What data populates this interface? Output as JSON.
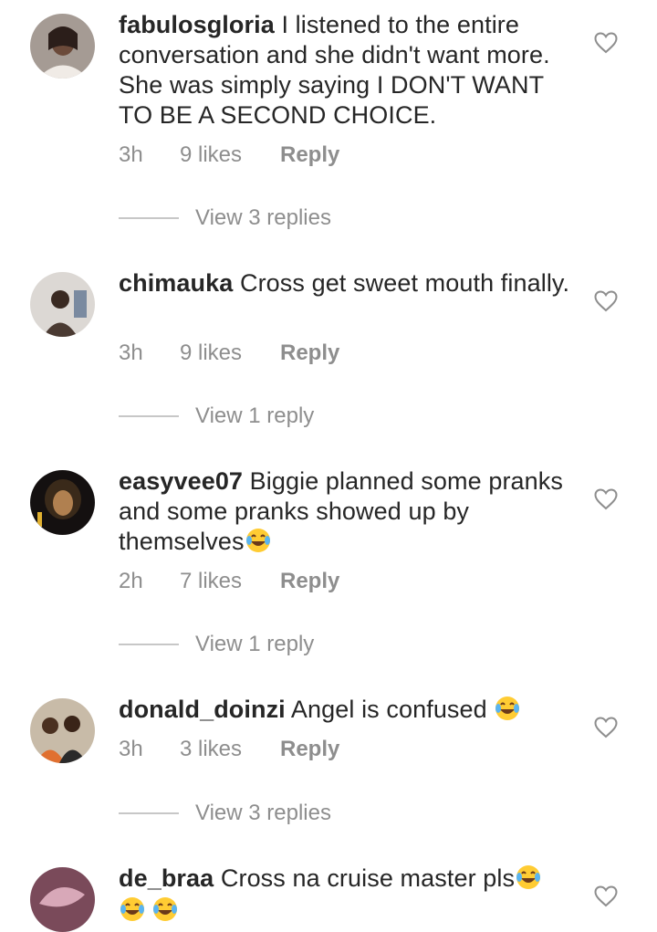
{
  "comments": [
    {
      "username": "fabulosgloria",
      "text": "I listened to the entire conversation and she didn't want more. She was simply saying I DON'T WANT TO BE A SECOND CHOICE.",
      "time": "3h",
      "likes": "9 likes",
      "reply_label": "Reply",
      "view_replies": "View 3 replies",
      "avatar_colors": [
        "#9a8f87",
        "#2b1e1a"
      ]
    },
    {
      "username": "chimauka",
      "text": "Cross get sweet mouth finally.",
      "time": "3h",
      "likes": "9 likes",
      "reply_label": "Reply",
      "view_replies": "View 1 reply",
      "avatar_colors": [
        "#d9d6d2",
        "#3a2a22"
      ]
    },
    {
      "username": "easyvee07",
      "text": "Biggie planned some pranks and some pranks showed up by themselves",
      "emoji": "face-with-tears-of-joy",
      "time": "2h",
      "likes": "7 likes",
      "reply_label": "Reply",
      "view_replies": "View 1 reply",
      "avatar_colors": [
        "#1a1410",
        "#8a6a3a"
      ]
    },
    {
      "username": "donald_doinzi",
      "text": "Angel is confused ",
      "emoji": "face-with-tears-of-joy",
      "time": "3h",
      "likes": "3 likes",
      "reply_label": "Reply",
      "view_replies": "View 3 replies",
      "avatar_colors": [
        "#cfc2b0",
        "#5a3a2a"
      ]
    },
    {
      "username": "de_braa",
      "text": "Cross na cruise master pls",
      "emoji": "face-with-tears-of-joy",
      "avatar_colors": [
        "#6b3a4a",
        "#c9a0b0"
      ]
    }
  ],
  "colors": {
    "text": "#262626",
    "muted": "#8e8e8e",
    "divider": "#c7c7c7"
  },
  "icons": {
    "like": "heart-outline-icon",
    "emoji": "face-with-tears-of-joy"
  }
}
